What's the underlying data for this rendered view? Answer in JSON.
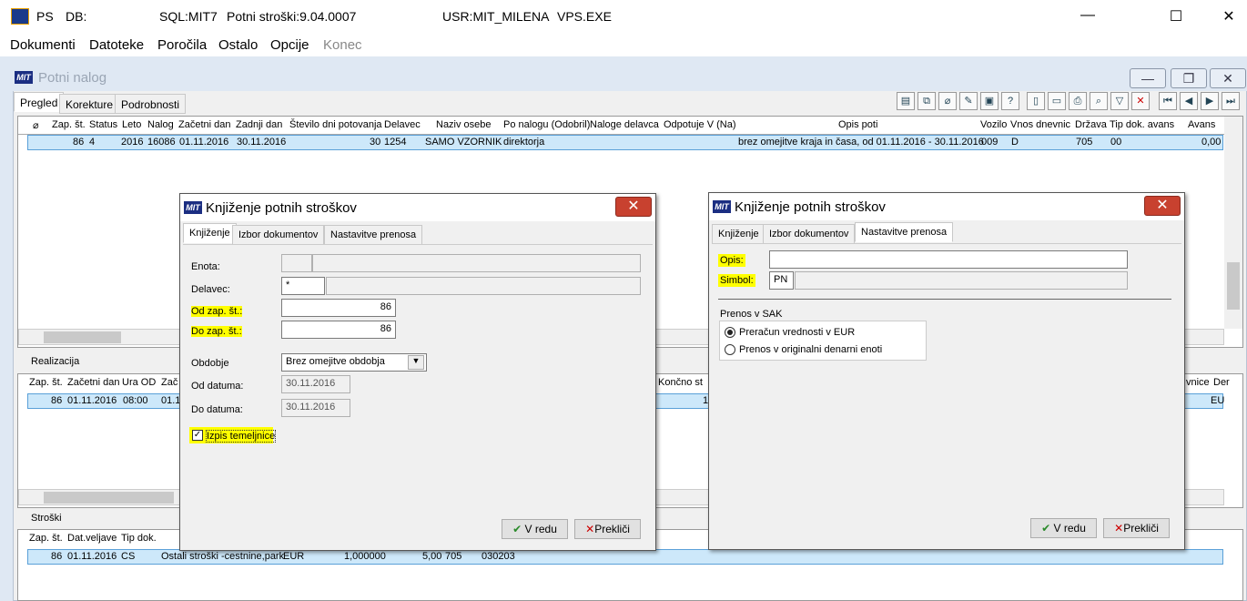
{
  "titlebar": {
    "app": "PS",
    "db_label": "DB:",
    "sql": "SQL:MIT7",
    "version": "Potni stroški:9.04.0007",
    "user": "USR:MIT_MILENA",
    "exe": "VPS.EXE"
  },
  "menu": [
    "Dokumenti",
    "Datoteke",
    "Poročila",
    "Ostalo",
    "Opcije",
    "Konec"
  ],
  "window": {
    "title": "Potni nalog",
    "logo": "MIT",
    "tabs": [
      "Pregled",
      "Korekture",
      "Podrobnosti"
    ]
  },
  "main_grid": {
    "headers": [
      "Zap. št.",
      "Status",
      "Leto",
      "Nalog",
      "Začetni dan",
      "Zadnji dan",
      "Število dni potovanja",
      "Delavec",
      "Naziv osebe",
      "Po nalogu (Odobril)",
      "Naloge delavca",
      "Odpotuje V (Na)",
      "Opis poti",
      "Vozilo",
      "Vnos dnevnic",
      "Država",
      "Tip dok. avans",
      "Avans"
    ],
    "row": [
      "86",
      "4",
      "2016",
      "16086",
      "01.11.2016",
      "30.11.2016",
      "30",
      "1254",
      "SAMO VZORNIK",
      "direktorja",
      "",
      "",
      "brez omejitve kraja in časa, od 01.11.2016 - 30.11.2016",
      "009",
      "D",
      "705",
      "00",
      "0,00"
    ]
  },
  "realizacija": {
    "title": "Realizacija",
    "headers": [
      "Zap. št.",
      "Začetni dan",
      "Ura OD",
      "Zač"
    ],
    "right_headers": [
      "Končno st",
      "vnice",
      "Der"
    ],
    "row": [
      "86",
      "01.11.2016",
      "08:00",
      "01.1"
    ],
    "right_row": [
      "1",
      "EU"
    ]
  },
  "stroski": {
    "title": "Stroški",
    "headers": [
      "Zap. št.",
      "Dat.veljave",
      "Tip dok."
    ],
    "row": [
      "86",
      "01.11.2016",
      "CS",
      "Ostali stroški -cestnine,park",
      "EUR",
      "1,000000",
      "5,00",
      "705",
      "030203"
    ]
  },
  "dialog1": {
    "title": "Knjiženje potnih stroškov",
    "tabs": [
      "Knjiženje",
      "Izbor dokumentov",
      "Nastavitve prenosa"
    ],
    "enota_label": "Enota:",
    "delavec_label": "Delavec:",
    "delavec_value": "*",
    "od_label": "Od zap. št.:",
    "od_value": "86",
    "do_label": "Do zap. št.:",
    "do_value": "86",
    "obdobje_label": "Obdobje",
    "obdobje_value": "Brez omejitve obdobja",
    "od_datuma_label": "Od datuma:",
    "od_datuma": "30.11.2016",
    "do_datuma_label": "Do datuma:",
    "do_datuma": "30.11.2016",
    "izpis_label": "Izpis temeljnice",
    "ok": "V redu",
    "cancel": "Prekliči"
  },
  "dialog2": {
    "title": "Knjiženje potnih stroškov",
    "tabs": [
      "Knjiženje",
      "Izbor dokumentov",
      "Nastavitve prenosa"
    ],
    "opis_label": "Opis:",
    "simbol_label": "Simbol:",
    "simbol_value": "PN",
    "group": "Prenos v SAK",
    "opt1": "Preračun vrednosti v EUR",
    "opt2": "Prenos v originalni denarni enoti",
    "ok": "V redu",
    "cancel": "Prekliči"
  }
}
